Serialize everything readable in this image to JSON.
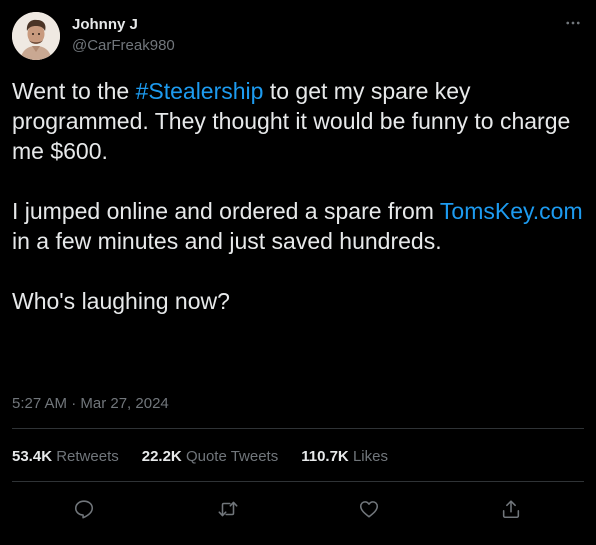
{
  "author": {
    "name": "Johnny J",
    "handle": "@CarFreak980"
  },
  "tweet": {
    "line1_pre": "Went to the ",
    "hashtag": "#Stealership",
    "line1_post": " to get my spare key programmed. They thought it would be funny to charge me $600.",
    "para2_pre": "I jumped online and ordered a spare from ",
    "link": "TomsKey.com",
    "para2_post": " in a few minutes and just saved hundreds.",
    "para3": "Who's laughing now?"
  },
  "timestamp": "5:27 AM · Mar 27, 2024",
  "stats": {
    "retweets_count": "53.4K",
    "retweets_label": "Retweets",
    "quotes_count": "22.2K",
    "quotes_label": "Quote Tweets",
    "likes_count": "110.7K",
    "likes_label": "Likes"
  },
  "icons": {
    "more": "more-horizontal-icon",
    "reply": "reply-icon",
    "retweet": "retweet-icon",
    "like": "heart-icon",
    "share": "share-icon"
  },
  "colors": {
    "background": "#000000",
    "text": "#e7e9ea",
    "muted": "#71767b",
    "link": "#1d9bf0",
    "divider": "#2f3336"
  }
}
